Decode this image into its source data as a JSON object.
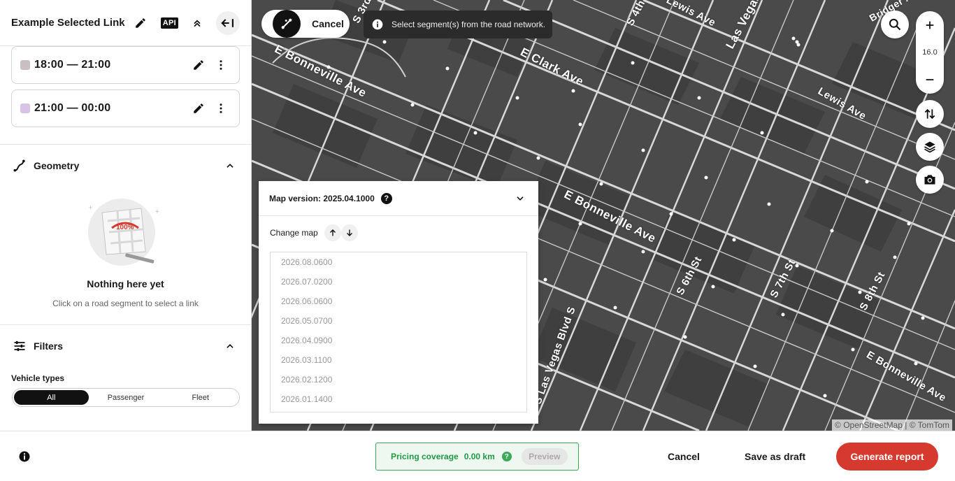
{
  "sidebar": {
    "title": "Example Selected Link",
    "api_label": "API",
    "time_ranges": [
      {
        "label": "18:00 — 21:00",
        "color": "#c9bfc2"
      },
      {
        "label": "21:00 — 00:00",
        "color": "#d6c3e6"
      }
    ],
    "geometry": {
      "title": "Geometry",
      "illustration_text": "100%",
      "empty_title": "Nothing here yet",
      "empty_subtitle": "Click on a road segment to select a link"
    },
    "filters": {
      "title": "Filters",
      "vehicle_types_label": "Vehicle types",
      "options": [
        "All",
        "Passenger",
        "Fleet"
      ],
      "selected": "All"
    }
  },
  "map": {
    "cancel_label": "Cancel",
    "toast_text": "Select segment(s) from the road network.",
    "zoom_level": "16.0",
    "attribution": "© OpenStreetMap | © TomTom",
    "street_labels": [
      "E Bonneville Ave",
      "E Clark Ave",
      "Lewis Ave",
      "Las Vegas",
      "S 4th",
      "S 3rd",
      "Bridger A",
      "E Bonneville Ave",
      "S 6th St",
      "S 7th St",
      "S 8th St",
      "S Las Vegas Blvd S",
      "E Bonneville Ave",
      "Lewis Ave"
    ],
    "map_version": {
      "title": "Map version: 2025.04.1000",
      "help": "?",
      "change_label": "Change map",
      "versions": [
        "2026.08.0600",
        "2026.07.0200",
        "2026.06.0600",
        "2026.05.0700",
        "2026.04.0900",
        "2026.03.1100",
        "2026.02.1200",
        "2026.01.1400"
      ]
    }
  },
  "footer": {
    "coverage_label": "Pricing coverage",
    "coverage_value": "0.00 km",
    "coverage_help": "?",
    "preview_label": "Preview",
    "cancel_label": "Cancel",
    "draft_label": "Save as draft",
    "generate_label": "Generate report"
  },
  "colors": {
    "accent_red": "#d63a2e",
    "coverage_green": "#3aaa5a",
    "map_bg": "#4a4a4a"
  }
}
